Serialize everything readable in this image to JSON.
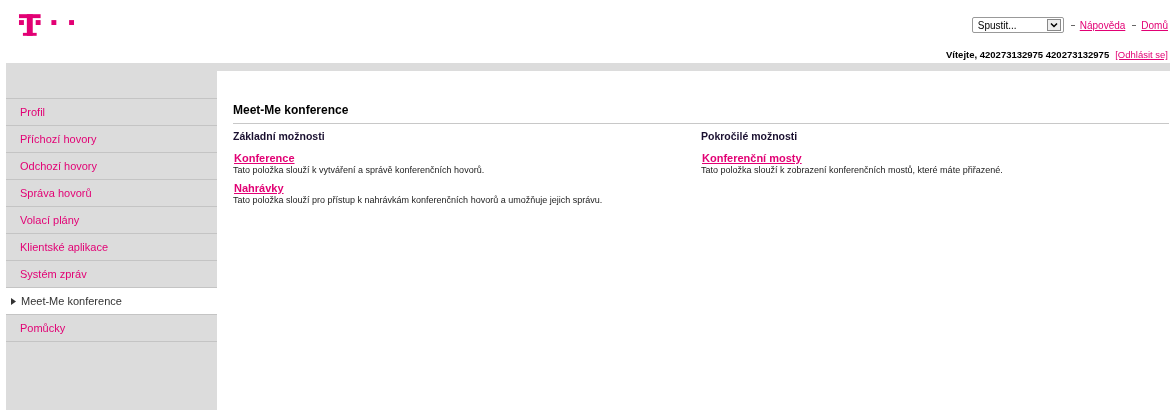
{
  "header": {
    "launcher": {
      "value": "Spustit..."
    },
    "links": [
      {
        "label": "Nápověda"
      },
      {
        "label": "Domů"
      }
    ],
    "welcome": "Vítejte, 420273132975 420273132975",
    "logout": "[Odhlásit se]"
  },
  "sidebar": {
    "items": [
      {
        "label": "Profil",
        "selected": false
      },
      {
        "label": "Příchozí hovory",
        "selected": false
      },
      {
        "label": "Odchozí hovory",
        "selected": false
      },
      {
        "label": "Správa hovorů",
        "selected": false
      },
      {
        "label": "Volací plány",
        "selected": false
      },
      {
        "label": "Klientské aplikace",
        "selected": false
      },
      {
        "label": "Systém zpráv",
        "selected": false
      },
      {
        "label": "Meet-Me konference",
        "selected": true
      },
      {
        "label": "Pomůcky",
        "selected": false
      }
    ]
  },
  "content": {
    "title": "Meet-Me konference",
    "sections": [
      {
        "heading": "Základní možnosti",
        "entries": [
          {
            "link": "Konference",
            "description": "Tato položka slouží k vytváření a správě konferenčních hovorů."
          },
          {
            "link": "Nahrávky",
            "description": "Tato položka slouží pro přístup k nahrávkám konferenčních hovorů a umožňuje jejich správu."
          }
        ]
      },
      {
        "heading": "Pokročilé možnosti",
        "entries": [
          {
            "link": "Konferenční mosty",
            "description": "Tato položka slouží k zobrazení konferenčních mostů, které máte přiřazené."
          }
        ]
      }
    ]
  }
}
